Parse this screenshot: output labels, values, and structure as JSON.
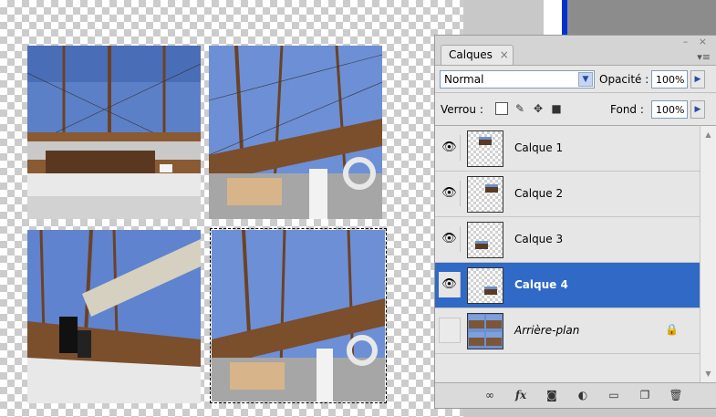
{
  "layers_panel": {
    "tab_title": "Calques",
    "tab_close": "×",
    "window_buttons": "– ×",
    "menu_icon": "▾≡",
    "blend_mode": "Normal",
    "opacity_label": "Opacité :",
    "opacity_value": "100%",
    "lock_label": "Verrou :",
    "fill_label": "Fond :",
    "fill_value": "100%",
    "layers": [
      {
        "name": "Calque 1",
        "visible": true,
        "active": false
      },
      {
        "name": "Calque 2",
        "visible": true,
        "active": false
      },
      {
        "name": "Calque 3",
        "visible": true,
        "active": false
      },
      {
        "name": "Calque 4",
        "visible": true,
        "active": true
      },
      {
        "name": "Arrière-plan",
        "visible": false,
        "active": false,
        "locked": true
      }
    ],
    "bottom_icons": [
      "link-icon",
      "fx-icon",
      "mask-icon",
      "adjustment-icon",
      "folder-icon",
      "new-layer-icon",
      "trash-icon"
    ],
    "fx_label": "fx"
  },
  "colors": {
    "active_layer": "#3169c6",
    "sky": "#6d8fcf",
    "wood": "#7b5638"
  }
}
